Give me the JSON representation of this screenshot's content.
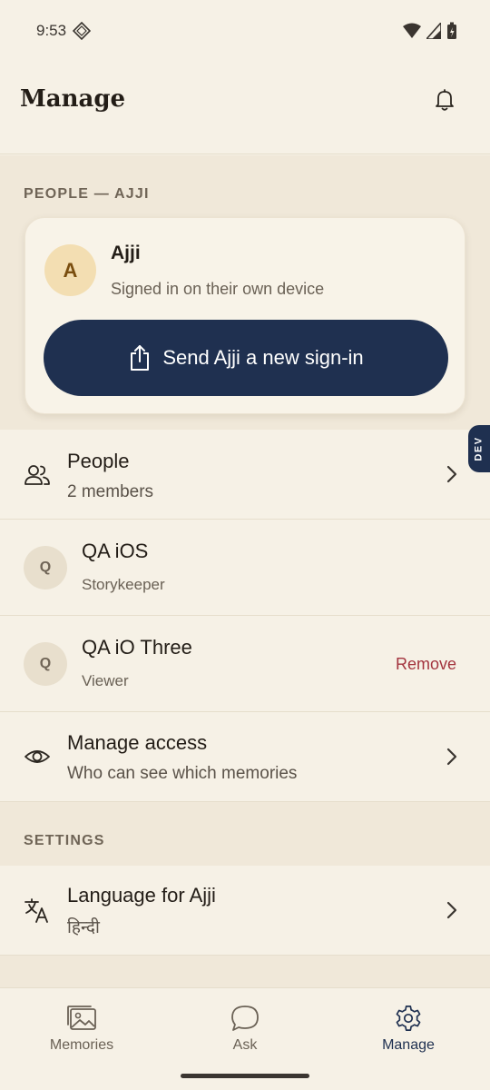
{
  "status": {
    "time": "9:53"
  },
  "header": {
    "title": "Manage"
  },
  "people_section": {
    "label": "PEOPLE — AJJI",
    "card": {
      "avatar_letter": "A",
      "name": "Ajji",
      "subtitle": "Signed in on their own device",
      "button_label": "Send Ajji a new sign-in"
    }
  },
  "rows": {
    "people": {
      "title": "People",
      "subtitle": "2 members"
    },
    "member1": {
      "avatar_letter": "Q",
      "name": "QA iOS",
      "role": "Storykeeper"
    },
    "member2": {
      "avatar_letter": "Q",
      "name": "QA iO Three",
      "role": "Viewer",
      "action": "Remove"
    },
    "access": {
      "title": "Manage access",
      "subtitle": "Who can see which memories"
    }
  },
  "dev_badge": "DEV",
  "settings_section": {
    "label": "SETTINGS",
    "language": {
      "title": "Language for Ajji",
      "value": "हिन्दी"
    }
  },
  "bottom_nav": {
    "items": [
      {
        "label": "Memories",
        "icon": "photos-icon"
      },
      {
        "label": "Ask",
        "icon": "chat-bubble-icon"
      },
      {
        "label": "Manage",
        "icon": "gear-icon"
      }
    ],
    "active": "Manage"
  },
  "colors": {
    "accent": "#1f3050",
    "background": "#f6f1e6",
    "section_bg": "#f0e8d9",
    "danger": "#a3343e"
  }
}
